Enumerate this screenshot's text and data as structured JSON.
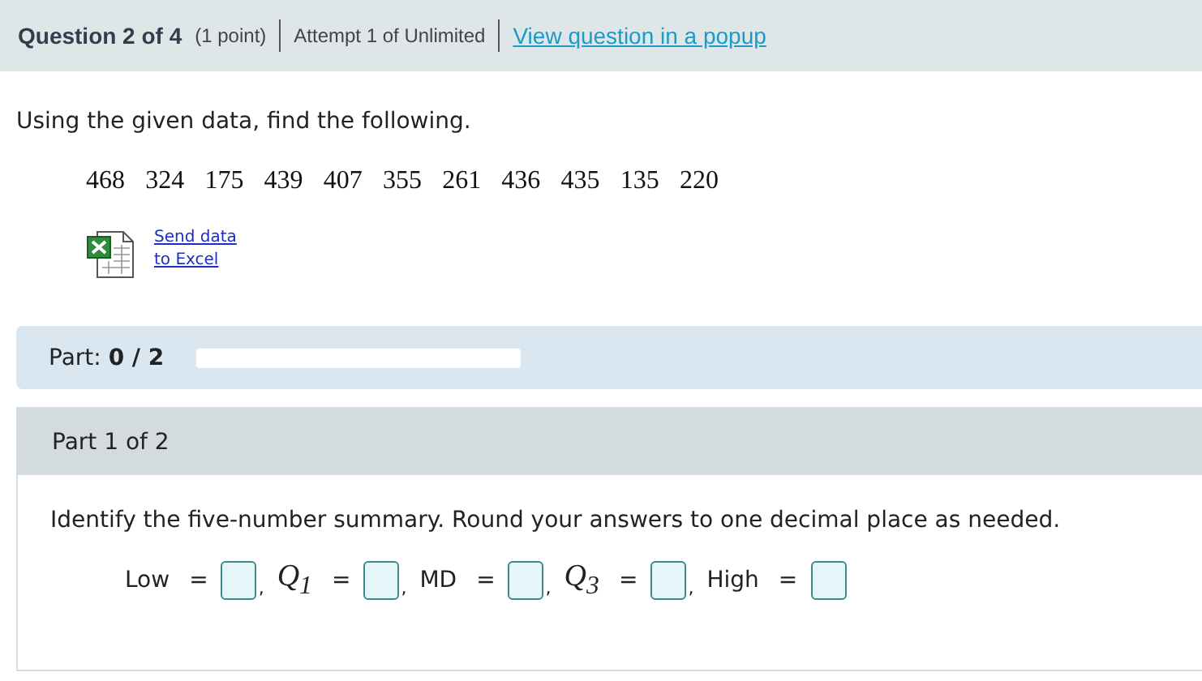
{
  "header": {
    "question": "Question 2 of 4",
    "points": "(1 point)",
    "attempt": "Attempt 1 of Unlimited",
    "popup_link": "View question in a popup"
  },
  "prompt": "Using the given data, find the following.",
  "data_values": [
    "468",
    "324",
    "175",
    "439",
    "407",
    "355",
    "261",
    "436",
    "435",
    "135",
    "220"
  ],
  "excel_link": {
    "line_1": "Send data",
    "line_2": "to Excel"
  },
  "progress": {
    "label": "Part:",
    "score": "0 / 2"
  },
  "part": {
    "title": "Part 1 of 2",
    "instruction": "Identify the five-number summary. Round your answers to one decimal place as needed.",
    "answers": [
      {
        "kind": "text",
        "label": "Low",
        "sign": "=",
        "separator": ","
      },
      {
        "kind": "math",
        "label": "Q$_{1}$",
        "sign": "=",
        "separator": ","
      },
      {
        "kind": "text",
        "label": "MD",
        "sign": "=",
        "separator": ","
      },
      {
        "kind": "math",
        "label": "Q$_{3}$",
        "sign": "=",
        "separator": ","
      },
      {
        "kind": "text",
        "label": "High",
        "sign": "="
      }
    ]
  }
}
